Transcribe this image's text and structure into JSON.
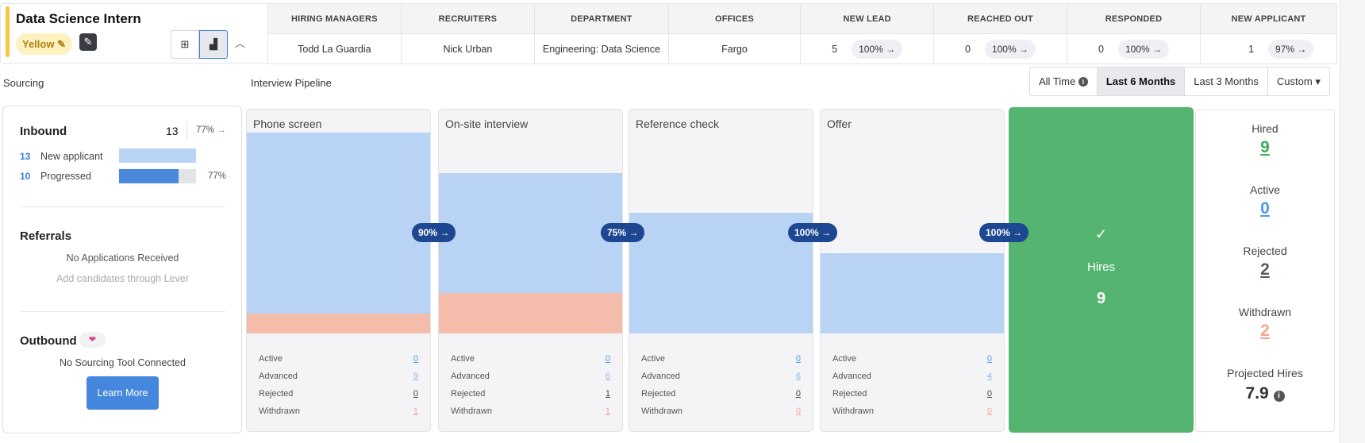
{
  "job": {
    "title": "Data Science Intern",
    "tag": "Yellow",
    "edit_icon": "pencil-icon",
    "status_icon": "pen-square-icon",
    "colors": {
      "tag_bg": "#fdf1c0",
      "bar": "#f5c842"
    }
  },
  "view_toggle": {
    "table_icon": "table-icon",
    "chart_icon": "chart-icon",
    "collapse_icon": "chevron-up-icon"
  },
  "header_table": {
    "columns": [
      "HIRING MANAGERS",
      "RECRUITERS",
      "DEPARTMENT",
      "OFFICES",
      "NEW LEAD",
      "REACHED OUT",
      "RESPONDED",
      "NEW APPLICANT"
    ],
    "row": [
      "Todd La Guardia",
      "Nick Urban",
      "Engineering: Data Science",
      "Fargo"
    ],
    "stages": [
      {
        "count": "5",
        "rate": "100% →"
      },
      {
        "count": "0",
        "rate": "100% →"
      },
      {
        "count": "0",
        "rate": "100% →"
      },
      {
        "count": "1",
        "rate": "97% →"
      }
    ]
  },
  "sections": {
    "sourcing": "Sourcing",
    "pipeline": "Interview Pipeline"
  },
  "date_filter": {
    "options": [
      "All Time",
      "Last 6 Months",
      "Last 3 Months",
      "Custom ▾"
    ],
    "selected": "Last 6 Months"
  },
  "sourcing": {
    "inbound": {
      "title": "Inbound",
      "total": "13",
      "rate": "77%",
      "arrow": "→",
      "rows": [
        {
          "count": "13",
          "label": "New applicant",
          "fill": 1.0
        },
        {
          "count": "10",
          "label": "Progressed",
          "fill": 0.77,
          "pct": "77%"
        }
      ]
    },
    "referrals": {
      "title": "Referrals",
      "empty": "No Applications Received",
      "hint": "Add candidates through Lever"
    },
    "outbound": {
      "title": "Outbound",
      "empty": "No Sourcing Tool Connected",
      "button": "Learn More"
    }
  },
  "stages": [
    {
      "name": "Phone screen",
      "active": "0",
      "advanced": "9",
      "rejected": "0",
      "withdrawn": "1",
      "conversion": "90% →"
    },
    {
      "name": "On-site interview",
      "active": "0",
      "advanced": "6",
      "rejected": "1",
      "withdrawn": "1",
      "conversion": "75% →"
    },
    {
      "name": "Reference check",
      "active": "0",
      "advanced": "6",
      "rejected": "0",
      "withdrawn": "0",
      "conversion": "100% →"
    },
    {
      "name": "Offer",
      "active": "0",
      "advanced": "4",
      "rejected": "0",
      "withdrawn": "0",
      "conversion": "100% →"
    }
  ],
  "stat_labels": {
    "active": "Active",
    "advanced": "Advanced",
    "rejected": "Rejected",
    "withdrawn": "Withdrawn"
  },
  "hires": {
    "check": "✓",
    "label": "Hires",
    "value": "9"
  },
  "summary": [
    {
      "label": "Hired",
      "value": "9",
      "color": "#3fae5c"
    },
    {
      "label": "Active",
      "value": "0",
      "color": "#4a9be8"
    },
    {
      "label": "Rejected",
      "value": "2",
      "color": "#555a66"
    },
    {
      "label": "Withdrawn",
      "value": "2",
      "color": "#f2a792"
    }
  ],
  "projected": {
    "label": "Projected Hires",
    "value": "7.9"
  },
  "colors": {
    "advanced": "#b8d3f3",
    "rejected_withdrawn": "#f4bcaa",
    "badge": "#1d4791",
    "hires": "#55b570",
    "link": "#3b7fdc"
  }
}
